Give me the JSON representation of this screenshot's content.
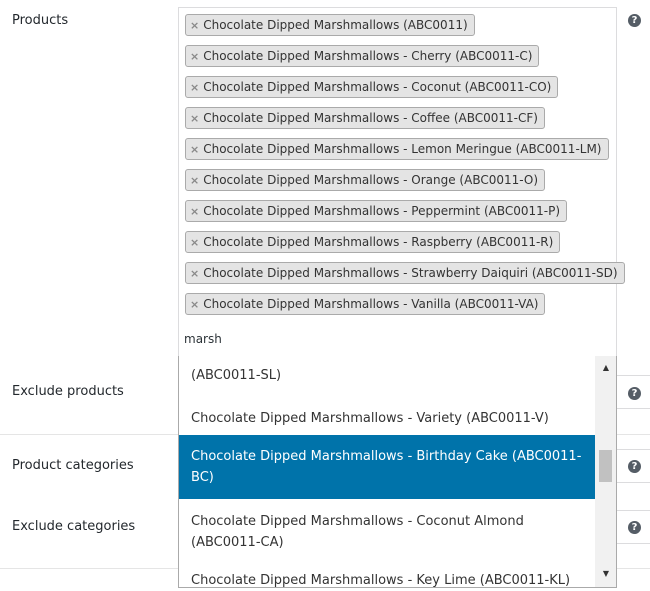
{
  "help_glyph": "?",
  "labels": {
    "products": "Products",
    "exclude_products": "Exclude products",
    "product_categories": "Product categories",
    "exclude_categories": "Exclude categories"
  },
  "products": {
    "selected": [
      "Chocolate Dipped Marshmallows (ABC0011)",
      "Chocolate Dipped Marshmallows - Cherry (ABC0011-C)",
      "Chocolate Dipped Marshmallows - Coconut (ABC0011-CO)",
      "Chocolate Dipped Marshmallows - Coffee (ABC0011-CF)",
      "Chocolate Dipped Marshmallows - Lemon Meringue (ABC0011-LM)",
      "Chocolate Dipped Marshmallows - Orange (ABC0011-O)",
      "Chocolate Dipped Marshmallows - Peppermint (ABC0011-P)",
      "Chocolate Dipped Marshmallows - Raspberry (ABC0011-R)",
      "Chocolate Dipped Marshmallows - Strawberry Daiquiri (ABC0011-SD)",
      "Chocolate Dipped Marshmallows - Vanilla (ABC0011-VA)"
    ],
    "remove_glyph": "×",
    "search_value": "marsh"
  },
  "dropdown": {
    "options": [
      {
        "lines": [
          "(ABC0011-SL)"
        ],
        "highlighted": false
      },
      {
        "lines": [
          "Chocolate Dipped Marshmallows - Variety (ABC0011-V)"
        ],
        "highlighted": false
      },
      {
        "lines": [
          "Chocolate Dipped Marshmallows - Birthday Cake (ABC0011-",
          "BC)"
        ],
        "highlighted": true
      },
      {
        "lines": [
          "Chocolate Dipped Marshmallows - Coconut Almond",
          "(ABC0011-CA)"
        ],
        "highlighted": false
      },
      {
        "lines": [
          "Chocolate Dipped Marshmallows - Key Lime (ABC0011-KL)"
        ],
        "highlighted": false
      }
    ],
    "scroll_up_glyph": "▲",
    "scroll_down_glyph": "▼"
  },
  "colors": {
    "highlight": "#0073aa",
    "chip_bg": "#e4e4e4"
  }
}
